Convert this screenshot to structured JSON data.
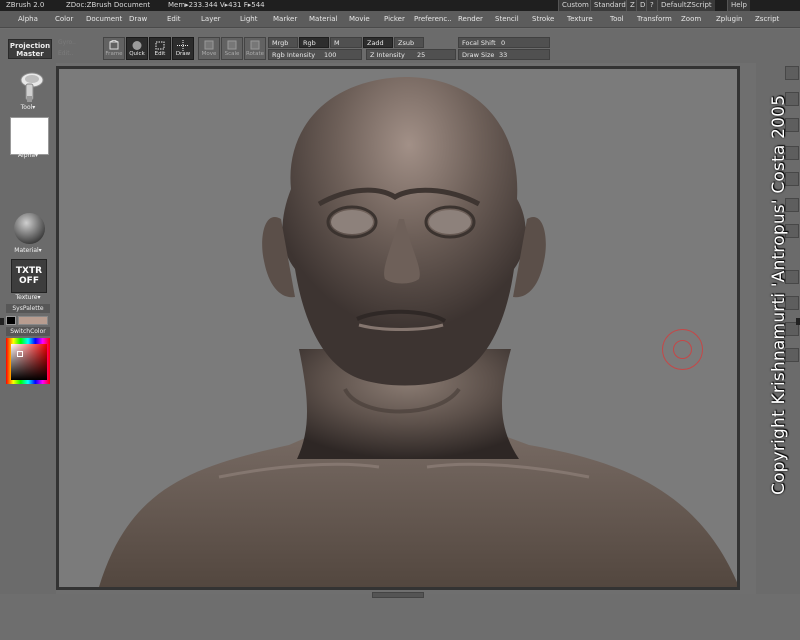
{
  "titlebar": {
    "app": "ZBrush 2.0",
    "doc": "ZDoc:ZBrush Document",
    "mem": "Mem▸233.344 V▸431 F▸544",
    "buttons": [
      "Custom",
      "Standard",
      "Z",
      "D",
      "?",
      "DefaultZScript",
      "Help"
    ]
  },
  "menu": [
    "Alpha",
    "Color",
    "Document",
    "Draw",
    "Edit",
    "Layer",
    "Light",
    "Marker",
    "Material",
    "Movie",
    "Picker",
    "Preferenc..",
    "Render",
    "Stencil",
    "Stroke",
    "Texture",
    "Tool",
    "Transform",
    "Zoom",
    "Zplugin",
    "Zscript"
  ],
  "shelf": {
    "projection_master": [
      "Projection",
      "Master"
    ],
    "ghost_left": [
      "Gyro..",
      "Edit.."
    ],
    "buttons": [
      {
        "label": "Frame"
      },
      {
        "label": "Quick"
      },
      {
        "label": "Edit"
      },
      {
        "label": "Draw"
      },
      {
        "label": "Move"
      },
      {
        "label": "Scale"
      },
      {
        "label": "Rotate"
      }
    ],
    "mrgb": "Mrgb",
    "rgb": "Rgb",
    "m": "M",
    "zadd": "Zadd",
    "zsub": "Zsub",
    "rgb_intensity_label": "Rgb Intensity",
    "rgb_intensity_value": "100",
    "z_intensity_label": "Z Intensity",
    "z_intensity_value": "25",
    "focal_shift_label": "Focal Shift",
    "focal_shift_value": "0",
    "draw_size_label": "Draw Size",
    "draw_size_value": "33"
  },
  "leftpanel": {
    "tool": "Tool▾",
    "alpha": "Alpha▾",
    "material": "Material▾",
    "texture_off": [
      "TXTR",
      "OFF"
    ],
    "texture": "Texture▾",
    "syspalette": "SysPalette",
    "switchcolor": "SwitchColor"
  },
  "canvas": {
    "subject": "sculpted head and shoulders of an elderly man"
  },
  "watermark": "Copyright Krishnamurti 'Antropus' Costa 2005",
  "colors": {
    "background": "#6f6f6f",
    "canvas": "#7b7b7b",
    "skin": "#6b5e57",
    "brush_ring": "#c54747"
  }
}
